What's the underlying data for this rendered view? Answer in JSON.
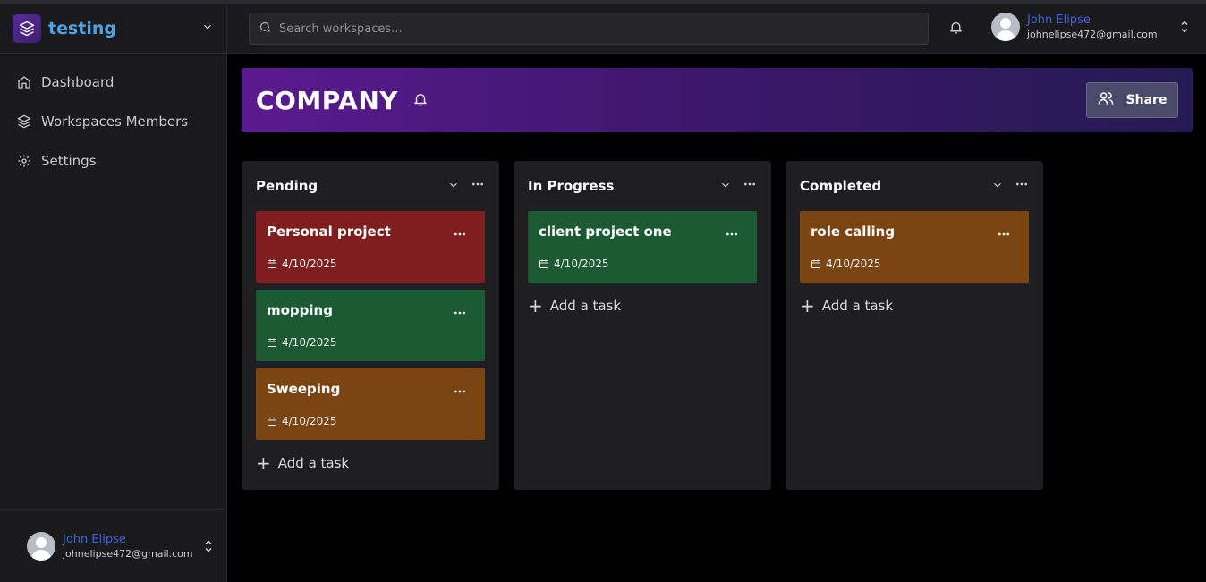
{
  "workspace": {
    "name": "testing"
  },
  "sidebar": {
    "items": [
      {
        "label": "Dashboard",
        "icon": "home-icon"
      },
      {
        "label": "Workspaces Members",
        "icon": "layers-icon"
      },
      {
        "label": "Settings",
        "icon": "gear-icon"
      }
    ]
  },
  "user": {
    "name": "John Elipse",
    "email": "johnelipse472@gmail.com"
  },
  "search": {
    "placeholder": "Search workspaces..."
  },
  "banner": {
    "title": "COMPANY",
    "share_label": "Share"
  },
  "board": {
    "add_task_label": "Add a task",
    "columns": [
      {
        "title": "Pending",
        "cards": [
          {
            "title": "Personal project",
            "date": "4/10/2025",
            "color": "#7f1e1e"
          },
          {
            "title": "mopping",
            "date": "4/10/2025",
            "color": "#1b5a32"
          },
          {
            "title": "Sweeping",
            "date": "4/10/2025",
            "color": "#7a4413"
          }
        ]
      },
      {
        "title": "In Progress",
        "cards": [
          {
            "title": "client project one",
            "date": "4/10/2025",
            "color": "#1b5a32"
          }
        ]
      },
      {
        "title": "Completed",
        "cards": [
          {
            "title": "role calling",
            "date": "4/10/2025",
            "color": "#7a4413"
          }
        ]
      }
    ]
  },
  "colors": {
    "accent_blue": "#4fa3e0",
    "user_name_blue": "#3e63d6",
    "banner_purple": "#5a1a8f"
  }
}
